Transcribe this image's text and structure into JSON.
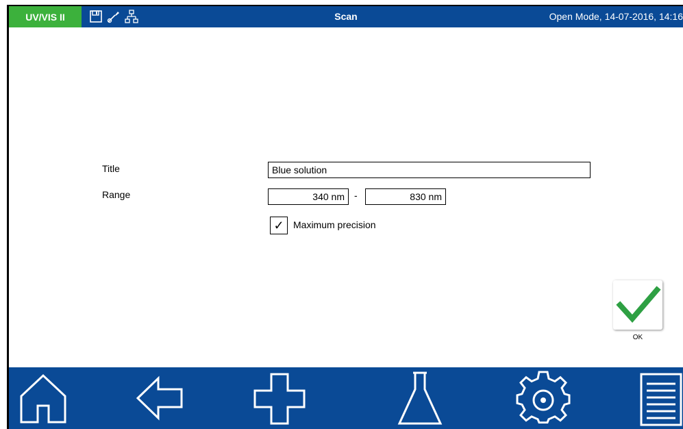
{
  "header": {
    "app_name": "UV/VIS II",
    "screen_title": "Scan",
    "status": "Open Mode, 14-07-2016, 14:16",
    "icons": [
      "save-icon",
      "probe-icon",
      "network-icon"
    ],
    "colors": {
      "bar": "#0a4a96",
      "badge": "#3cb13c"
    }
  },
  "form": {
    "title_label": "Title",
    "title_value": "Blue solution",
    "range_label": "Range",
    "range_from": "340 nm",
    "range_to": "830 nm",
    "range_separator": "-",
    "precision_checked": true,
    "precision_label": "Maximum precision"
  },
  "ok": {
    "label": "OK",
    "icon": "checkmark-icon",
    "color": "#2ea043"
  },
  "nav": {
    "items": [
      "home-icon",
      "back-icon",
      "add-icon",
      "flask-icon",
      "settings-icon",
      "menu-icon"
    ]
  }
}
